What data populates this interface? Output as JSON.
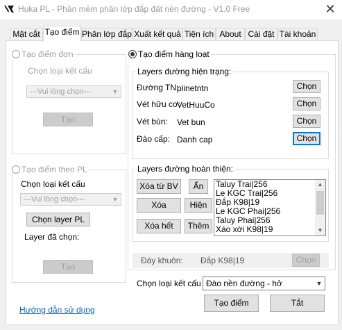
{
  "window": {
    "title": "Huka PL - Phần mềm phân lớp đắp đất nền đường - V1.0 Free",
    "close": "✕"
  },
  "tabs": [
    {
      "label": "Mặt cắt"
    },
    {
      "label": "Tạo điểm"
    },
    {
      "label": "Phân lớp đắp"
    },
    {
      "label": "Xuất kết quả"
    },
    {
      "label": "Tiện ích"
    },
    {
      "label": "About"
    },
    {
      "label": "Cài đặt"
    },
    {
      "label": "Tài khoản"
    }
  ],
  "single_point": {
    "title": "Tạo điểm đơn",
    "structure_label": "Chọn loại kết cấu",
    "select_value": "---Vui lòng chọn---",
    "create_button": "Tạo"
  },
  "pl_point": {
    "title": "Tạo điểm theo PL",
    "structure_label": "Chọn loại kết cấu",
    "select_value": "---Vui lòng chọn---",
    "choose_layer_button": "Chọn layer PL",
    "selected_label": "Layer đã chọn:",
    "create_button": "Tạo"
  },
  "bulk": {
    "title": "Tạo điểm hàng loạt",
    "current_layers": {
      "title": "Layers đường hiện trạng:",
      "rows": [
        {
          "label": "Đường TN:",
          "value": "plinetntn",
          "button": "Chọn"
        },
        {
          "label": "Vét hữu cơ:",
          "value": "VetHuuCo",
          "button": "Chọn"
        },
        {
          "label": "Vét bùn:",
          "value": "Vet bun",
          "button": "Chọn"
        },
        {
          "label": "Đào cấp:",
          "value": "Danh cap",
          "button": "Chọn"
        }
      ]
    },
    "finished_layers": {
      "title": "Layers đường hoàn thiện:",
      "buttons": {
        "delete_from_bv": "Xóa từ BV",
        "hide": "Ẩn",
        "delete": "Xóa",
        "show": "Hiện",
        "delete_all": "Xóa hết",
        "add": "Thêm"
      },
      "items": [
        "Taluy Trai|256",
        "Le KGC Trai|256",
        "Đắp  K98|19",
        "Le KGC Phai|256",
        "Taluy Phai|256",
        "Xáo xới K98|19"
      ]
    },
    "bottom": {
      "label": "Đáy khuôn:",
      "value": "Đắp  K98|19",
      "button": "Chọn"
    },
    "structure_label": "Chọn loại kết cấu",
    "structure_value": "Đào nền đường - hở",
    "create_button": "Tạo điểm",
    "exit_button": "Tắt"
  },
  "help_link": "Hướng dẫn sử dụng",
  "colors": {
    "accent": "#0078d7",
    "link": "#0066cc",
    "disabled": "#a0a0a0"
  }
}
